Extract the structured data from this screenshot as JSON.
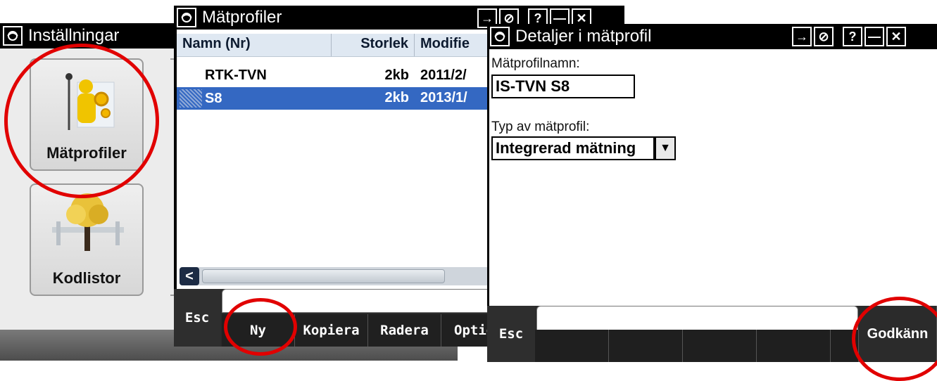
{
  "settings_window": {
    "title": "Inställningar",
    "tiles": [
      {
        "label": "Mätprofiler",
        "icon": "survey-profile-icon"
      },
      {
        "label": "Kodlistor",
        "icon": "code-list-tree-icon"
      }
    ]
  },
  "profiles_window": {
    "title": "Mätprofiler",
    "columns": [
      "Namn (Nr)",
      "Storlek",
      "Modifie"
    ],
    "rows": [
      {
        "name": "RTK-TVN",
        "size": "2kb",
        "modified": "2011/2/",
        "selected": false
      },
      {
        "name": "S8",
        "size": "2kb",
        "modified": "2013/1/",
        "selected": true
      }
    ],
    "softkeys": {
      "esc": "Esc",
      "new": "Ny",
      "copy": "Kopiera",
      "delete": "Radera",
      "options": "Optio"
    },
    "titlebar_buttons": [
      "→",
      "⊘",
      "?",
      "—",
      "✕"
    ]
  },
  "details_window": {
    "title": "Detaljer i mätprofil",
    "name_label": "Mätprofilnamn:",
    "name_value": "IS-TVN S8",
    "type_label": "Typ av mätprofil:",
    "type_value": "Integrerad mätning",
    "softkeys": {
      "esc": "Esc",
      "accept": "Godkänn"
    },
    "titlebar_buttons": [
      "→",
      "⊘",
      "?",
      "—",
      "✕"
    ]
  },
  "colors": {
    "highlight": "#e10000",
    "selection": "#3468c2",
    "titlebar": "#000000"
  }
}
